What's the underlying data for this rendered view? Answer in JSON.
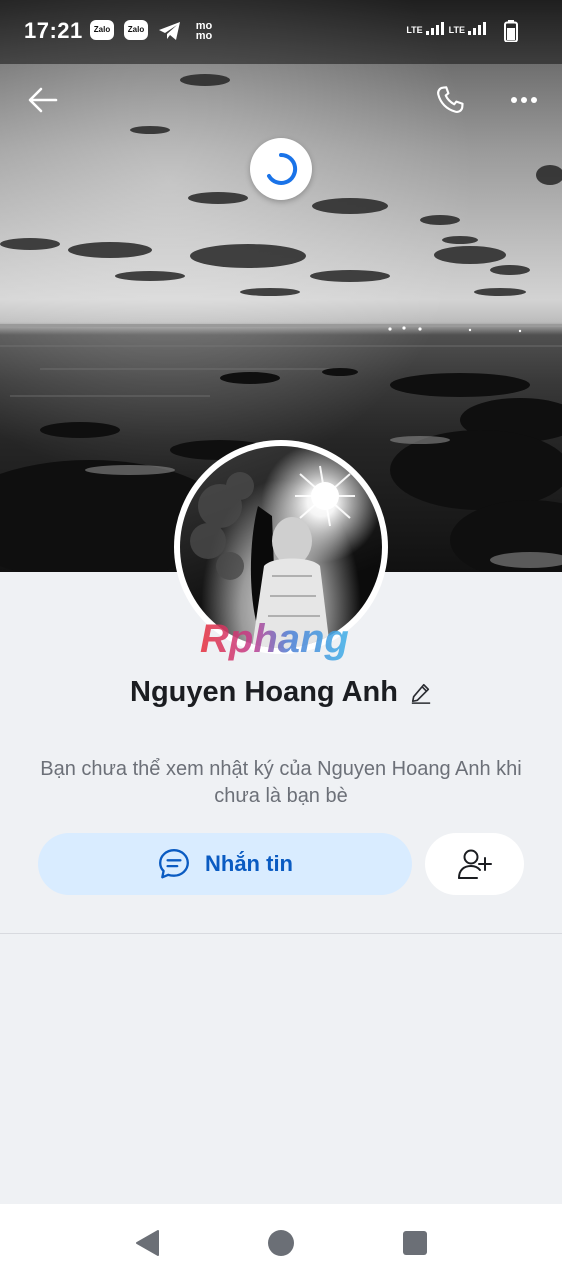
{
  "status_bar": {
    "time": "17:21",
    "app_icons": [
      "zalo",
      "zalo",
      "telegram-icon",
      "momo"
    ],
    "zalo_label": "Zalo",
    "momo_label": "mo\nmo",
    "network_1": "LTE",
    "network_2": "LTE"
  },
  "header": {
    "back_icon": "arrow-left-icon",
    "call_icon": "phone-icon",
    "more_icon": "more-horizontal-icon",
    "loading_icon": "loading-spinner-icon"
  },
  "profile": {
    "name": "Nguyen Hoang Anh",
    "watermark": "Rphang",
    "notice": "Bạn chưa thể xem nhật ký của Nguyen Hoang Anh khi chưa là bạn bè"
  },
  "actions": {
    "message_label": "Nhắn tin",
    "message_icon": "chat-bubble-icon",
    "add_friend_icon": "add-user-icon"
  },
  "nav": {
    "back_icon": "nav-back-icon",
    "home_icon": "nav-home-icon",
    "recents_icon": "nav-recents-icon"
  },
  "colors": {
    "accent": "#0a5bc2",
    "message_button_bg": "#d9ecff",
    "page_bg": "#eff1f4"
  }
}
